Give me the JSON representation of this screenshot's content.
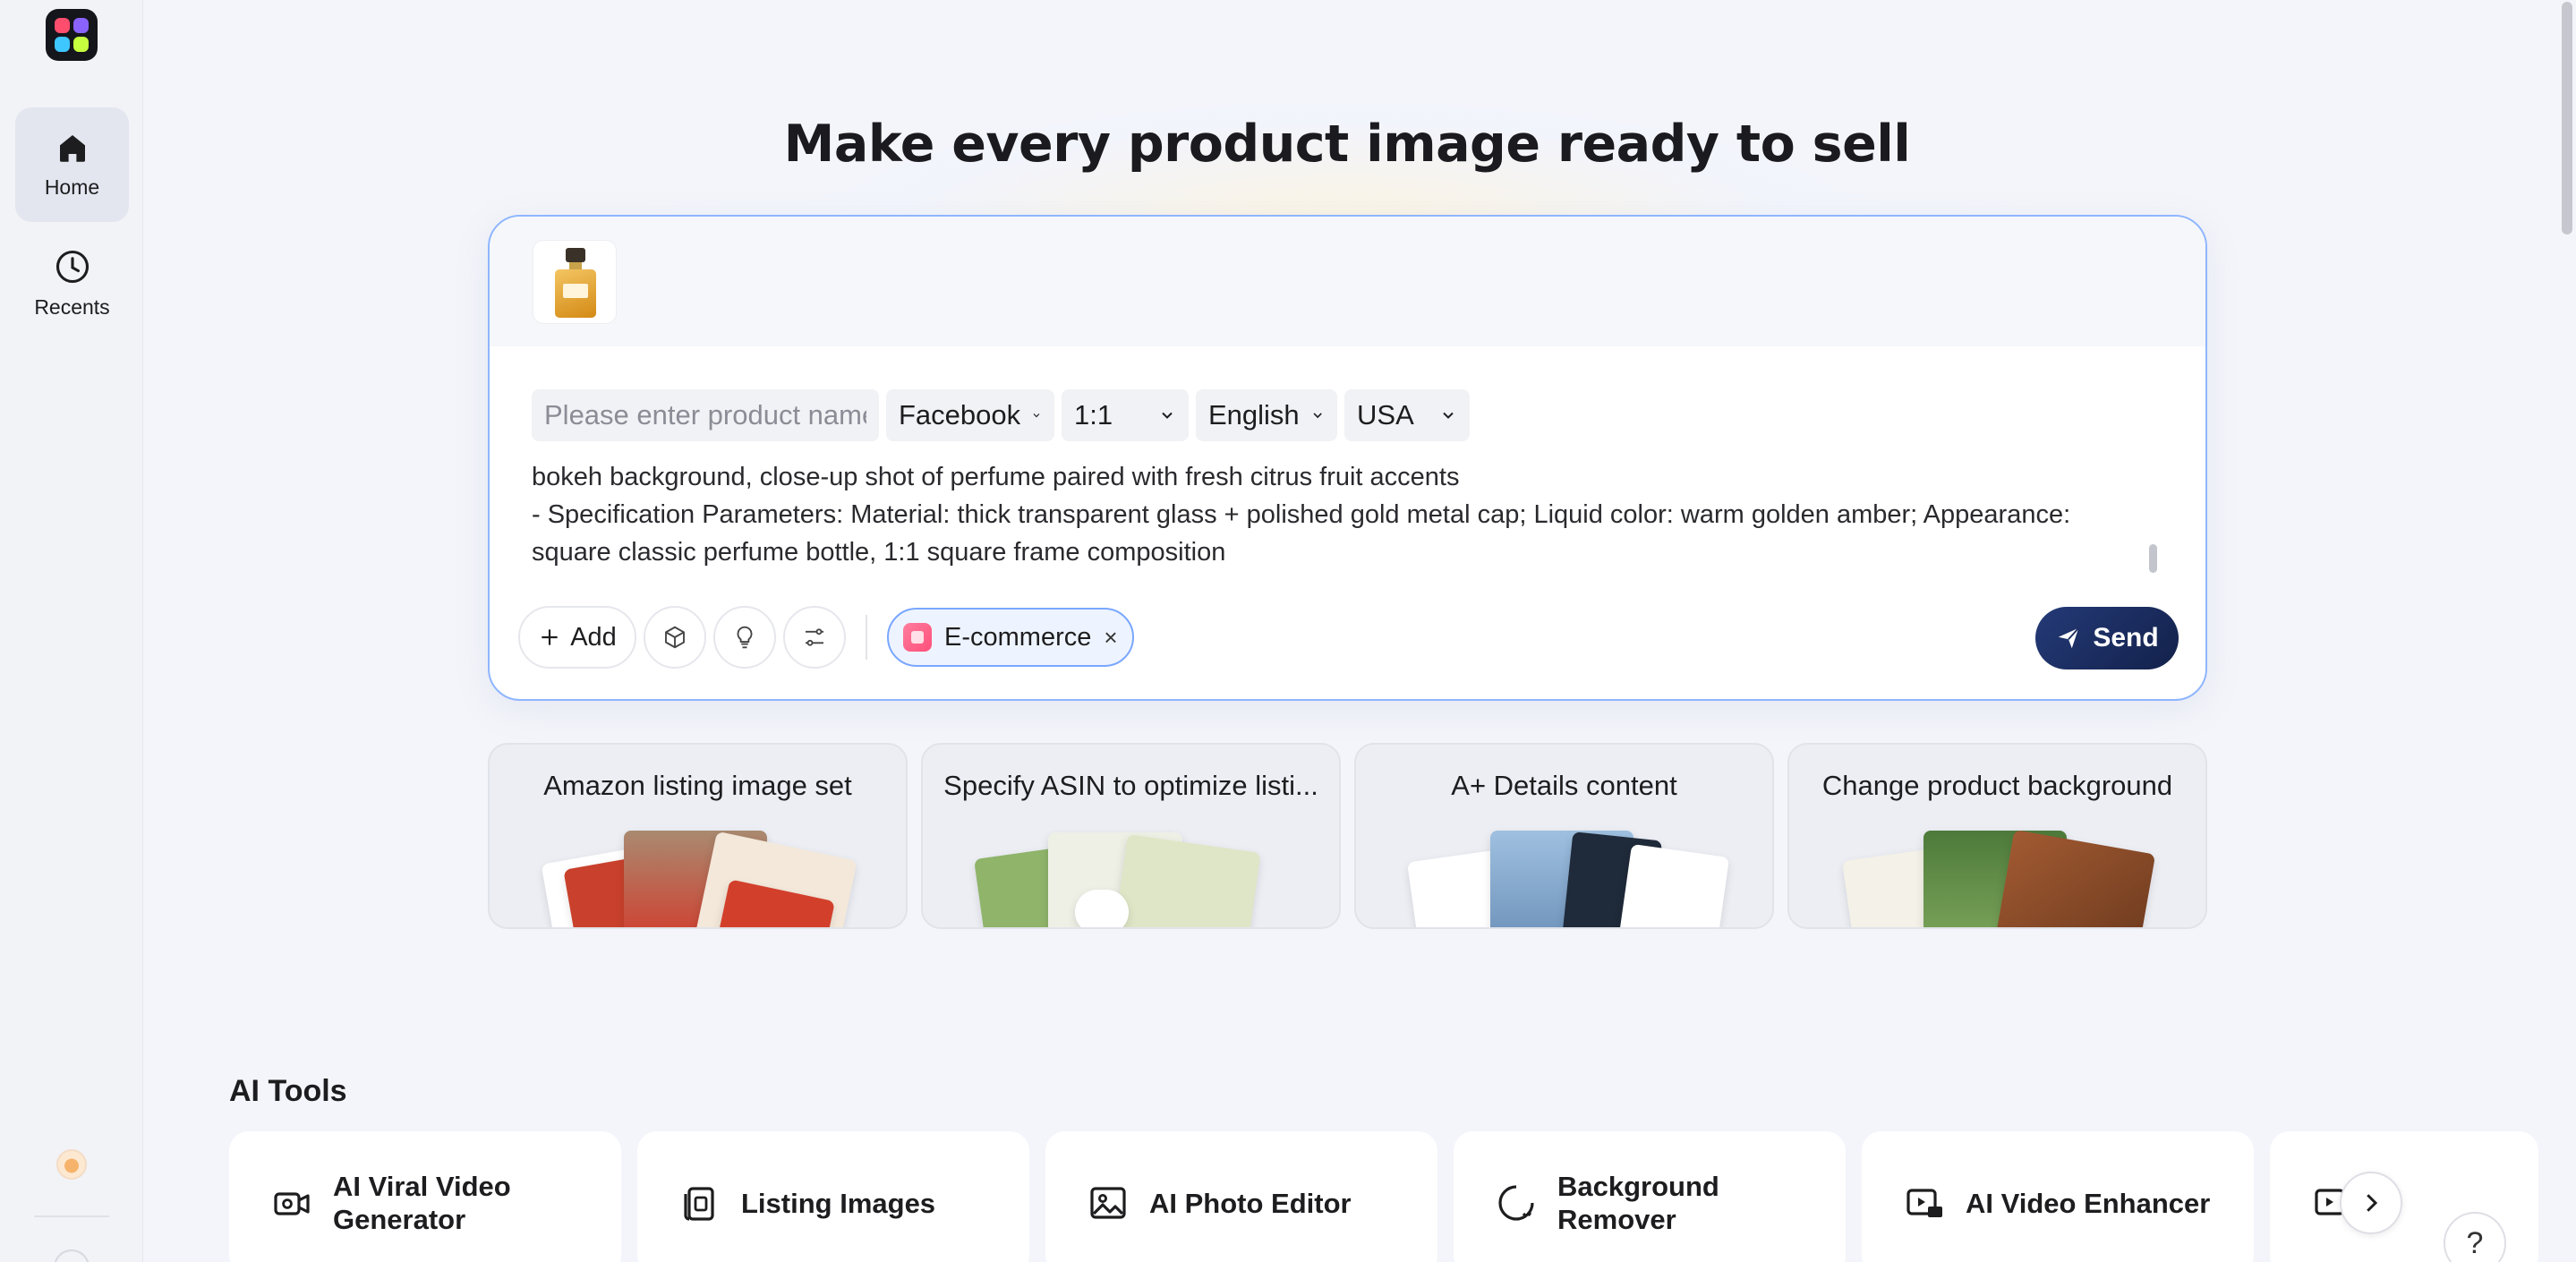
{
  "sidebar": {
    "items": [
      {
        "label": "Home",
        "icon": "home-icon",
        "active": true
      },
      {
        "label": "Recents",
        "icon": "clock-icon",
        "active": false
      }
    ]
  },
  "hero": {
    "title": "Make every product image ready to sell"
  },
  "composer": {
    "product_name_placeholder": "Please enter product name",
    "platform": "Facebook",
    "ratio": "1:1",
    "language": "English",
    "country": "USA",
    "prompt_lines": [
      "bokeh background, close-up shot of perfume paired with fresh citrus fruit accents",
      "- Specification Parameters: Material: thick transparent glass + polished gold metal cap; Liquid color: warm golden amber; Appearance:",
      "square classic perfume bottle, 1:1 square frame composition"
    ],
    "add_label": "Add",
    "tag_label": "E-commerce",
    "tag_close": "×",
    "send_label": "Send"
  },
  "quick_cards": [
    {
      "title": "Amazon listing image set"
    },
    {
      "title": "Specify ASIN to optimize listi..."
    },
    {
      "title": "A+ Details content"
    },
    {
      "title": "Change product background"
    }
  ],
  "ai_tools": {
    "section_title": "AI Tools",
    "items": [
      {
        "label": "AI Viral Video Generator",
        "icon": "video-camera-icon"
      },
      {
        "label": "Listing Images",
        "icon": "listing-images-icon"
      },
      {
        "label": "AI Photo Editor",
        "icon": "photo-editor-icon"
      },
      {
        "label": "Background Remover",
        "icon": "background-remover-icon"
      },
      {
        "label": "AI Video Enhancer",
        "icon": "video-hd-icon"
      }
    ]
  },
  "help_label": "?",
  "colors": {
    "accent_border": "#8eb6ff",
    "send_bg": "#1b2d5e",
    "tag_bg": "#eef4ff"
  }
}
